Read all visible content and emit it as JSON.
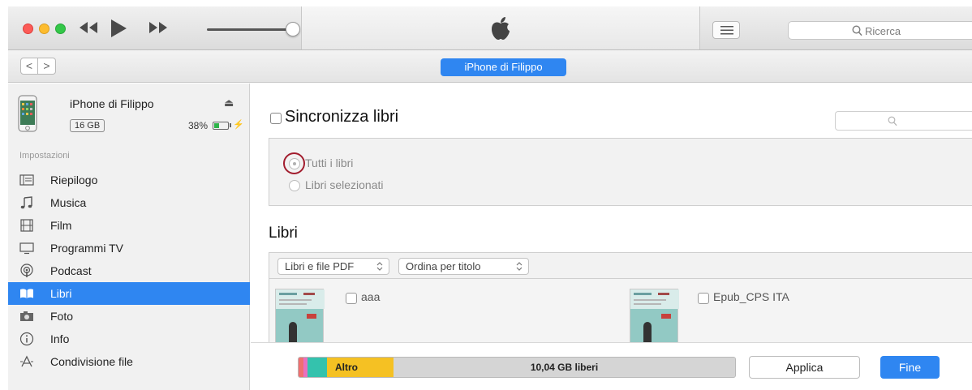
{
  "toolbar": {
    "search_placeholder": "Ricerca"
  },
  "nav": {
    "back_label": "<",
    "forward_label": ">",
    "device_pill": "iPhone di Filippo"
  },
  "device": {
    "name": "iPhone di Filippo",
    "eject_icon": "⏏",
    "capacity": "16 GB",
    "battery_text": "38%",
    "battery_level": 0.38
  },
  "sidebar": {
    "section_title": "Impostazioni",
    "items": [
      {
        "label": "Riepilogo",
        "icon": "summary-icon",
        "active": false
      },
      {
        "label": "Musica",
        "icon": "music-note-icon",
        "active": false
      },
      {
        "label": "Film",
        "icon": "film-icon",
        "active": false
      },
      {
        "label": "Programmi TV",
        "icon": "tv-icon",
        "active": false
      },
      {
        "label": "Podcast",
        "icon": "podcast-icon",
        "active": false
      },
      {
        "label": "Libri",
        "icon": "book-icon",
        "active": true
      },
      {
        "label": "Foto",
        "icon": "camera-icon",
        "active": false
      },
      {
        "label": "Info",
        "icon": "info-icon",
        "active": false
      },
      {
        "label": "Condivisione file",
        "icon": "file-sharing-icon",
        "active": false
      }
    ]
  },
  "main": {
    "sync_title": "Sincronizza libri",
    "options": [
      "Tutti i libri",
      "Libri selezionati"
    ],
    "libri_title": "Libri",
    "filter_dropdown": "Libri e file PDF",
    "sort_dropdown": "Ordina per titolo",
    "books": [
      {
        "name": "aaa"
      },
      {
        "name": "Epub_CPS ITA"
      }
    ]
  },
  "bottom": {
    "storage_other_label": "Altro",
    "storage_free_label": "10,04 GB liberi",
    "apply_label": "Applica",
    "done_label": "Fine"
  },
  "colors": {
    "accent": "#2f86f1",
    "highlight_ring": "#a21d2e",
    "storage_other": "#f5c123"
  }
}
